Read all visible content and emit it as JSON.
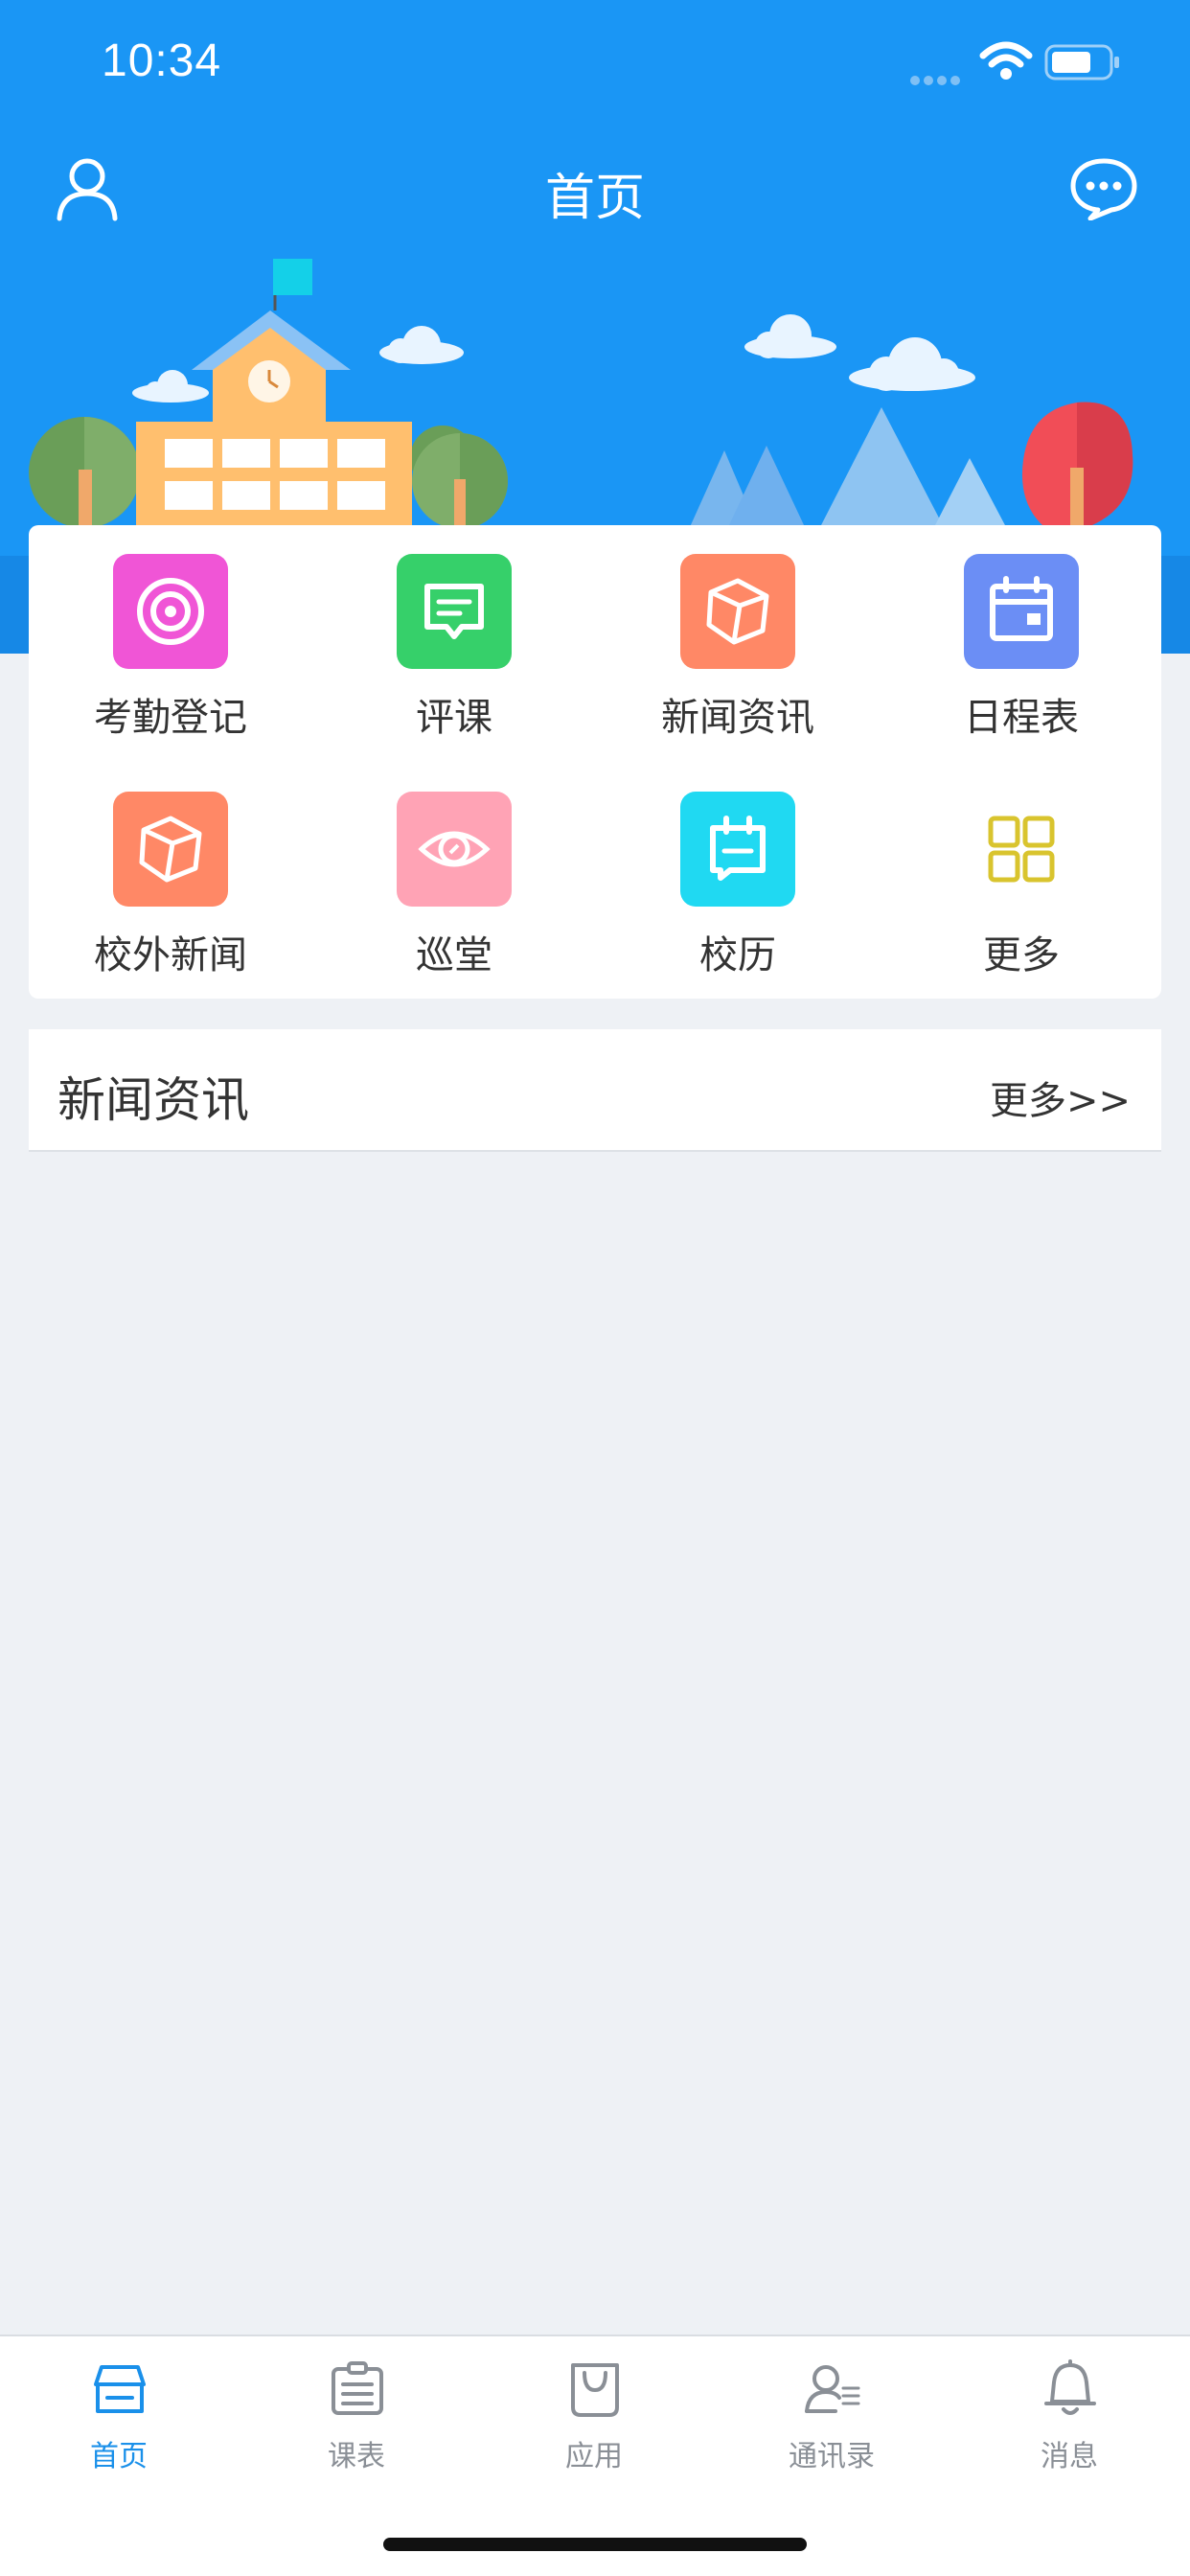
{
  "status_bar": {
    "time": "10:34"
  },
  "nav": {
    "title": "首页"
  },
  "colors": {
    "header_blue": "#1a96f5",
    "active_tab": "#1a90ea",
    "inactive_tab": "#8a8f96",
    "background": "#eef1f5"
  },
  "menu": {
    "items": [
      {
        "label": "考勤登记",
        "icon": "attendance-icon",
        "color": "#f055d6"
      },
      {
        "label": "评课",
        "icon": "comment-icon",
        "color": "#36d06a"
      },
      {
        "label": "新闻资讯",
        "icon": "news-icon",
        "color": "#ff8866"
      },
      {
        "label": "日程表",
        "icon": "calendar-icon",
        "color": "#6b8ef5"
      },
      {
        "label": "校外新闻",
        "icon": "external-news-icon",
        "color": "#ff8866"
      },
      {
        "label": "巡堂",
        "icon": "eye-icon",
        "color": "#ffa3b5"
      },
      {
        "label": "校历",
        "icon": "school-calendar-icon",
        "color": "#20d9f2"
      },
      {
        "label": "更多",
        "icon": "grid-icon",
        "color": "#d9c42e"
      }
    ]
  },
  "news": {
    "title": "新闻资讯",
    "more": "更多>>"
  },
  "tabbar": {
    "items": [
      {
        "label": "首页",
        "icon": "home-icon",
        "active": true
      },
      {
        "label": "课表",
        "icon": "timetable-icon",
        "active": false
      },
      {
        "label": "应用",
        "icon": "bag-icon",
        "active": false
      },
      {
        "label": "通讯录",
        "icon": "contacts-icon",
        "active": false
      },
      {
        "label": "消息",
        "icon": "bell-icon",
        "active": false
      }
    ]
  }
}
